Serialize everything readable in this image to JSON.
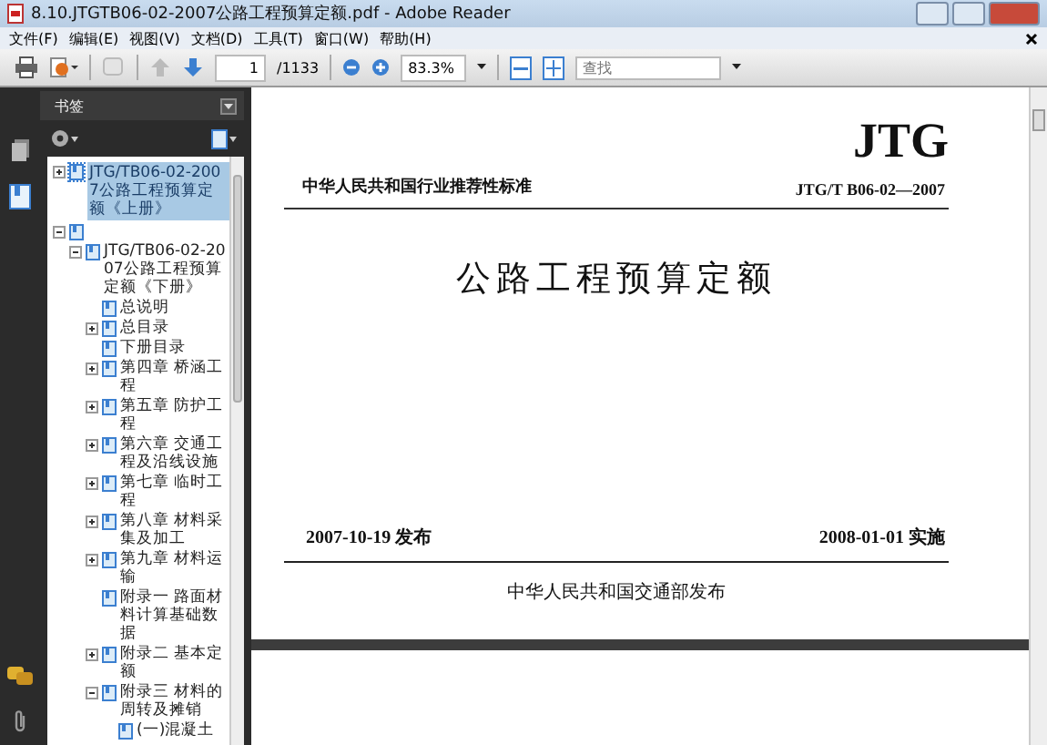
{
  "window": {
    "title": "8.10.JTGTB06-02-2007公路工程预算定额.pdf - Adobe Reader"
  },
  "menu": [
    "文件(F)",
    "编辑(E)",
    "视图(V)",
    "文档(D)",
    "工具(T)",
    "窗口(W)",
    "帮助(H)"
  ],
  "toolbar": {
    "page": "1",
    "page_count": "/1133",
    "zoom": "83.3%",
    "search": {
      "placeholder": "查找"
    }
  },
  "bookmarks": {
    "title": "书签",
    "tree": [
      {
        "label": "JTG/TB06-02-2007公路工程预算定额《上册》",
        "expanded": false,
        "selected": true
      },
      {
        "expanded": true,
        "selected": false,
        "children": [
          {
            "label": "JTG/TB06-02-2007公路工程预算定额《下册》",
            "expanded": true,
            "selected": false,
            "children": [
              {
                "label": "总说明",
                "selected": false
              },
              {
                "label": "总目录",
                "expanded": false,
                "selected": false
              },
              {
                "label": "下册目录",
                "selected": false
              },
              {
                "label": "第四章  桥涵工程",
                "expanded": false,
                "selected": false
              },
              {
                "label": "第五章  防护工程",
                "expanded": false,
                "selected": false
              },
              {
                "label": "第六章 交通工程及沿线设施",
                "expanded": false,
                "selected": false
              },
              {
                "label": "第七章  临时工程",
                "expanded": false,
                "selected": false
              },
              {
                "label": "第八章 材料采集及加工",
                "expanded": false,
                "selected": false
              },
              {
                "label": "第九章 材料运输",
                "expanded": false,
                "selected": false
              },
              {
                "label": "附录一 路面材料计算基础数据",
                "selected": false
              },
              {
                "label": "附录二 基本定额",
                "expanded": false,
                "selected": false
              },
              {
                "label": "附录三 材料的周转及摊销",
                "expanded": true,
                "selected": false,
                "children": [
                  {
                    "label": "(一)混凝土",
                    "selected": false
                  }
                ]
              }
            ]
          }
        ]
      }
    ]
  },
  "document": {
    "logo": "JTG",
    "category": "中华人民共和国行业推荐性标准",
    "code": "JTG/T B06-02—2007",
    "title": "公路工程预算定额",
    "issued": "2007-10-19 发布",
    "effective": "2008-01-01 实施",
    "publisher": "中华人民共和国交通部发布"
  }
}
